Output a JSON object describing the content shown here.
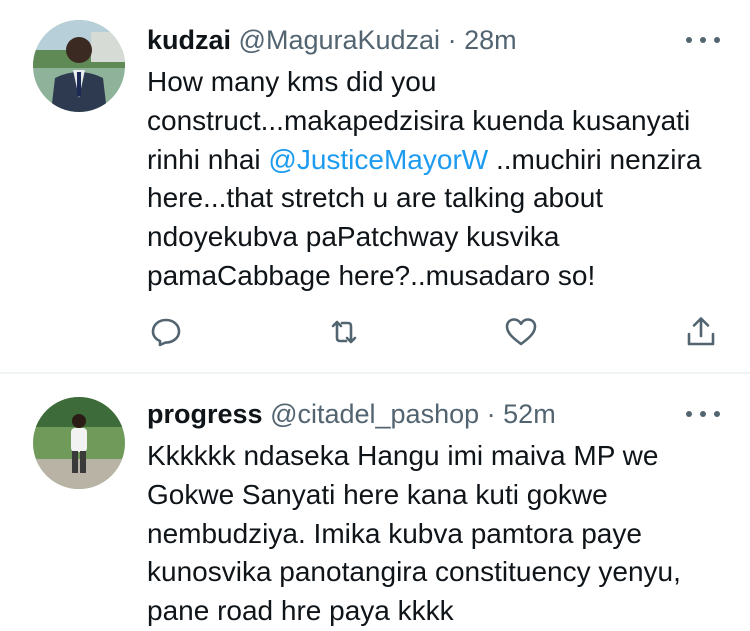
{
  "tweets": [
    {
      "name": "kudzai",
      "handle": "@MaguraKudzai",
      "separator": "·",
      "time": "28m",
      "text_before": "How many kms did you\nconstruct...makapedzisira kuenda kusanyati\nrinhi nhai ",
      "mention": "@JusticeMayorW",
      "text_after": " ..muchiri nenzira\nhere...that stretch u are talking about\nndoyekubva paPatchway kusvika\npamaCabbage here?..musadaro so!",
      "actions": [
        "reply-icon",
        "retweet-icon",
        "like-icon",
        "share-icon"
      ]
    },
    {
      "name": "progress",
      "handle": "@citadel_pashop",
      "separator": "·",
      "time": "52m",
      "text": "Kkkkkk ndaseka Hangu imi maiva MP we\nGokwe Sanyati here kana kuti gokwe\nnembudziya. Imika kubva pamtora paye\nkunosvika panotangira constituency yenyu,\npane road hre paya kkkk"
    }
  ],
  "colors": {
    "text": "#0f1419",
    "secondary": "#536471",
    "link": "#1d9bf0",
    "divider": "#eff3f4"
  }
}
